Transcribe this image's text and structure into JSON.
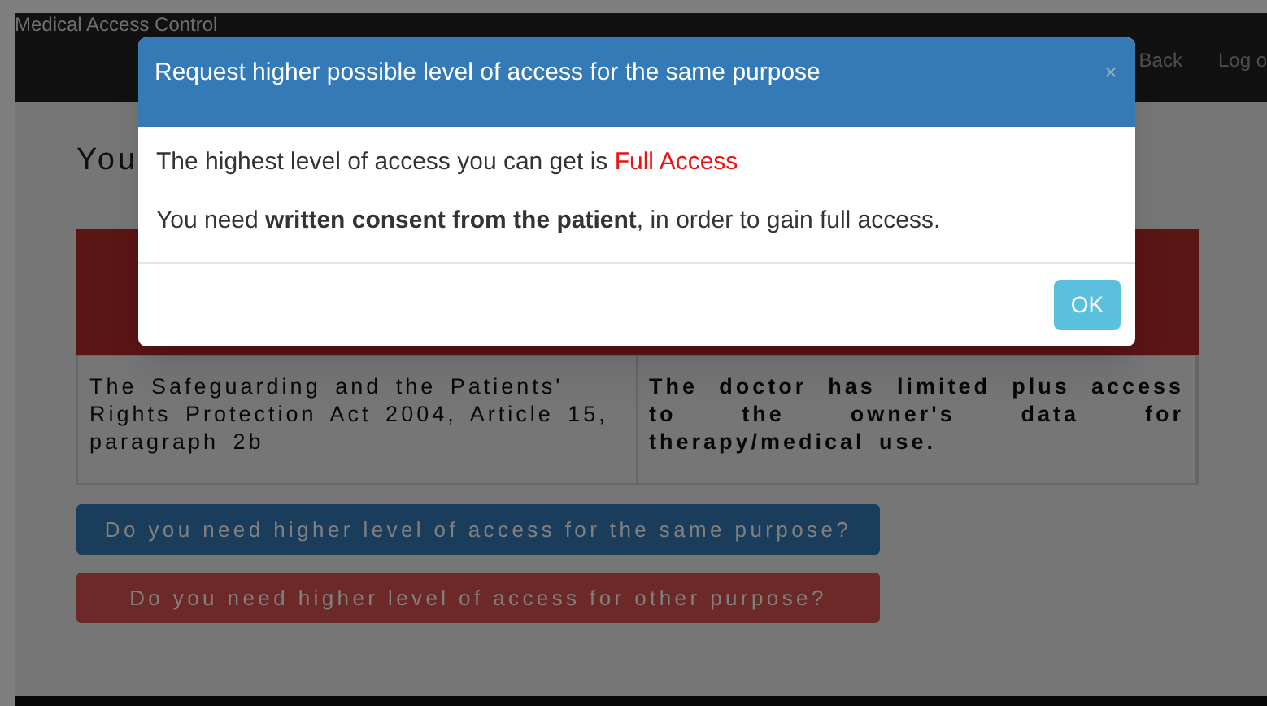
{
  "navbar": {
    "brand": "Medical Access Control",
    "links": [
      {
        "label": "Back"
      },
      {
        "label": "Log o"
      }
    ]
  },
  "page": {
    "heading": "You",
    "table": {
      "rows": [
        {
          "cells": [
            {
              "text": "The Safeguarding and the Patients' Rights Protection Act 2004, Article 15, paragraph 2b",
              "bold": false
            },
            {
              "text": "The doctor has limited plus access to the owner's data for therapy/medical use.",
              "bold": true
            }
          ]
        }
      ]
    },
    "buttons": [
      {
        "label": "Do you need higher level of access for the same purpose?",
        "kind": "primary"
      },
      {
        "label": "Do you need higher level of access for other purpose?",
        "kind": "danger"
      }
    ]
  },
  "modal": {
    "title": "Request higher possible level of access for the same purpose",
    "close": "×",
    "lines": [
      {
        "text": "The highest level of access you can get is",
        "highlight": "Full Access"
      },
      {
        "text": "You need **written consent from the patient**, in order to gain full access."
      }
    ],
    "ok": "OK"
  }
}
